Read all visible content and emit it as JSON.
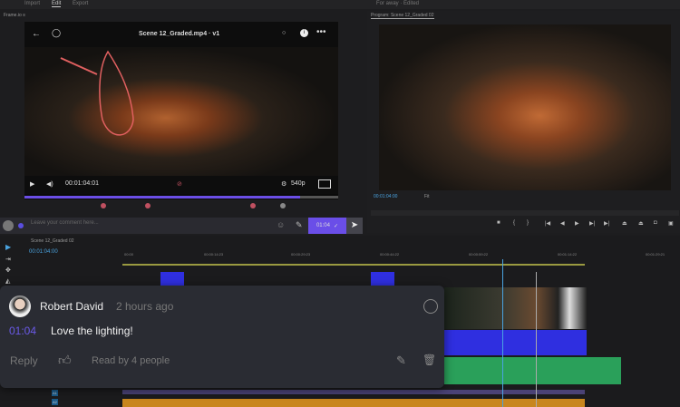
{
  "topbar": {
    "tabs": [
      "Import",
      "Edit",
      "Export"
    ],
    "active_tab": "Edit",
    "right_label": "For away · Edited"
  },
  "source_panel": {
    "title": "Frame.io",
    "menu_icon": "hamburger-icon"
  },
  "player": {
    "file_title": "Scene 12_Graded.mp4 · v1",
    "timecode": "00:01:04:01",
    "quality": "540p",
    "progress_percent": 88
  },
  "comment_bar": {
    "placeholder": "Leave your comment here...",
    "timestamp": "01:04",
    "send_icon": "send-icon"
  },
  "program": {
    "title": "Program: Scene 12_Graded 02",
    "timecode": "00:01:04:00",
    "fit": "Fit"
  },
  "timeline": {
    "sequence": "Scene 12_Graded 02",
    "timecode": "00:01:04:00",
    "ruler": [
      "00:00",
      "00:00:14:23",
      "00:00:29:23",
      "00:00:44:22",
      "00:00:59:22",
      "00:01:14:22",
      "00:01:29:21"
    ],
    "track_labels": [
      "A1",
      "A2"
    ]
  },
  "comment": {
    "author": "Robert David",
    "time_ago": "2 hours ago",
    "timestamp": "01:04",
    "text": "Love the lighting!",
    "reply_label": "Reply",
    "read_by": "Read by 4 people"
  },
  "colors": {
    "accent": "#6a4ee8",
    "timecode": "#4aa3e0",
    "video_clip": "#2f2fe0",
    "audio_clip": "#2aa05a",
    "audio_track": "#c8861e"
  }
}
